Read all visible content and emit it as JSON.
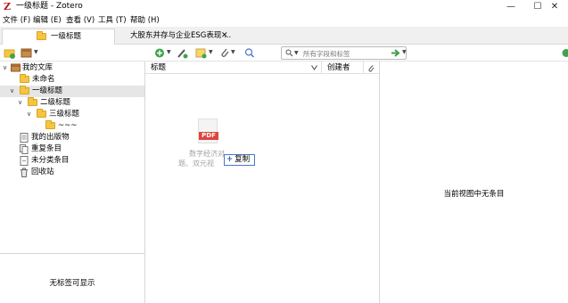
{
  "window": {
    "title": "一级标题 - Zotero",
    "app_icon": "Z",
    "controls": {
      "minimize": "—",
      "maximize": "☐",
      "close": "✕"
    }
  },
  "menu": [
    {
      "label": "文件 (F)"
    },
    {
      "label": "编辑 (E)"
    },
    {
      "label": "查看 (V)"
    },
    {
      "label": "工具 (T)"
    },
    {
      "label": "帮助 (H)"
    }
  ],
  "tabs": [
    {
      "label": "一级标题",
      "active": true
    },
    {
      "label": "大股东并存与企业ESG表现 ...",
      "close": "✕",
      "active": false
    }
  ],
  "toolbar": {
    "search_placeholder": "所有字段和标签",
    "icons": [
      "new-collection-icon",
      "new-library-icon",
      "new-item-icon",
      "add-by-identifier-icon",
      "new-note-icon",
      "add-attachment-icon",
      "locate-icon",
      "search-icon",
      "sync-icon"
    ]
  },
  "library": {
    "items": [
      {
        "label": "我的文库",
        "type": "library"
      },
      {
        "label": "未命名",
        "type": "folder"
      },
      {
        "label": "一级标题",
        "type": "folder",
        "selected": true
      },
      {
        "label": "二级标题",
        "type": "folder"
      },
      {
        "label": "三级标题",
        "type": "folder"
      },
      {
        "label": "~~~",
        "type": "folder"
      },
      {
        "label": "我的出版物",
        "type": "special"
      },
      {
        "label": "重复条目",
        "type": "special"
      },
      {
        "label": "未分类条目",
        "type": "special"
      },
      {
        "label": "回收站",
        "type": "trash"
      }
    ]
  },
  "tags": {
    "empty_message": "无标签可显示"
  },
  "items": {
    "columns": {
      "title": "标题",
      "creator": "创建者"
    }
  },
  "drag": {
    "badge_text": "PDF",
    "line1": "数字经济对",
    "line2": "题、双元视",
    "copy_label": "复制",
    "copy_symbol": "+"
  },
  "detail": {
    "empty_message": "当前视图中无条目"
  }
}
